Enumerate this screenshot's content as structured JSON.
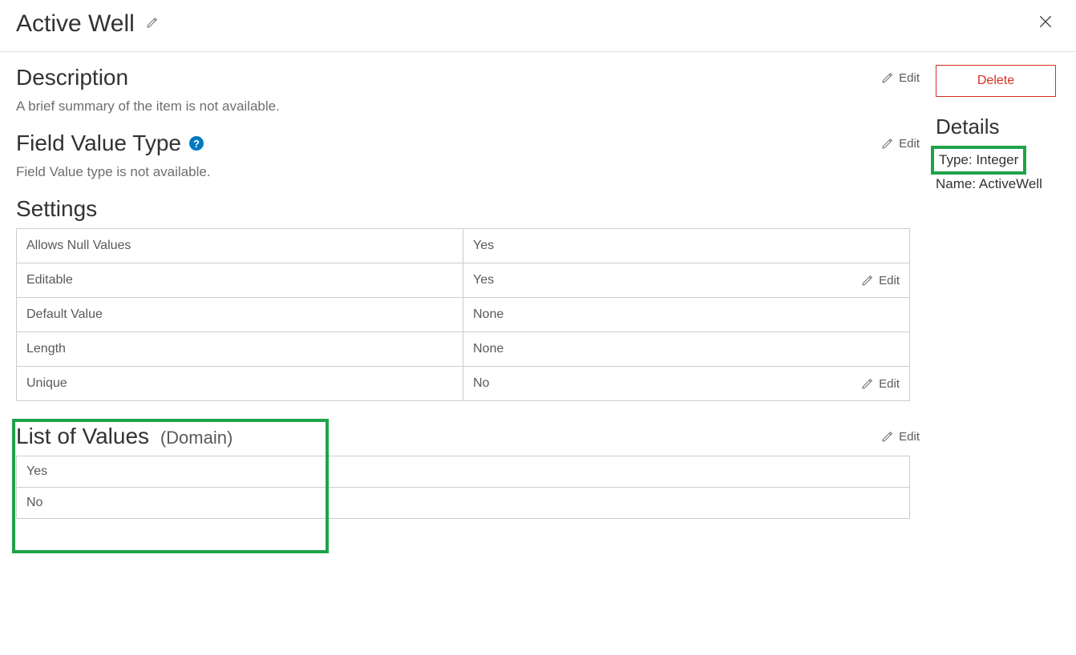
{
  "header": {
    "title": "Active Well"
  },
  "labels": {
    "edit": "Edit",
    "delete": "Delete"
  },
  "description": {
    "heading": "Description",
    "text": "A brief summary of the item is not available."
  },
  "fieldValueType": {
    "heading": "Field Value Type",
    "text": "Field Value type is not available."
  },
  "settings": {
    "heading": "Settings",
    "rows": [
      {
        "label": "Allows Null Values",
        "value": "Yes",
        "editable": false
      },
      {
        "label": "Editable",
        "value": "Yes",
        "editable": true
      },
      {
        "label": "Default Value",
        "value": "None",
        "editable": false
      },
      {
        "label": "Length",
        "value": "None",
        "editable": false
      },
      {
        "label": "Unique",
        "value": "No",
        "editable": true
      }
    ]
  },
  "listOfValues": {
    "heading": "List of Values",
    "subheading": "(Domain)",
    "items": [
      "Yes",
      "No"
    ]
  },
  "details": {
    "heading": "Details",
    "typeLabel": "Type",
    "typeValue": "Integer",
    "nameLabel": "Name",
    "nameValue": "ActiveWell"
  }
}
